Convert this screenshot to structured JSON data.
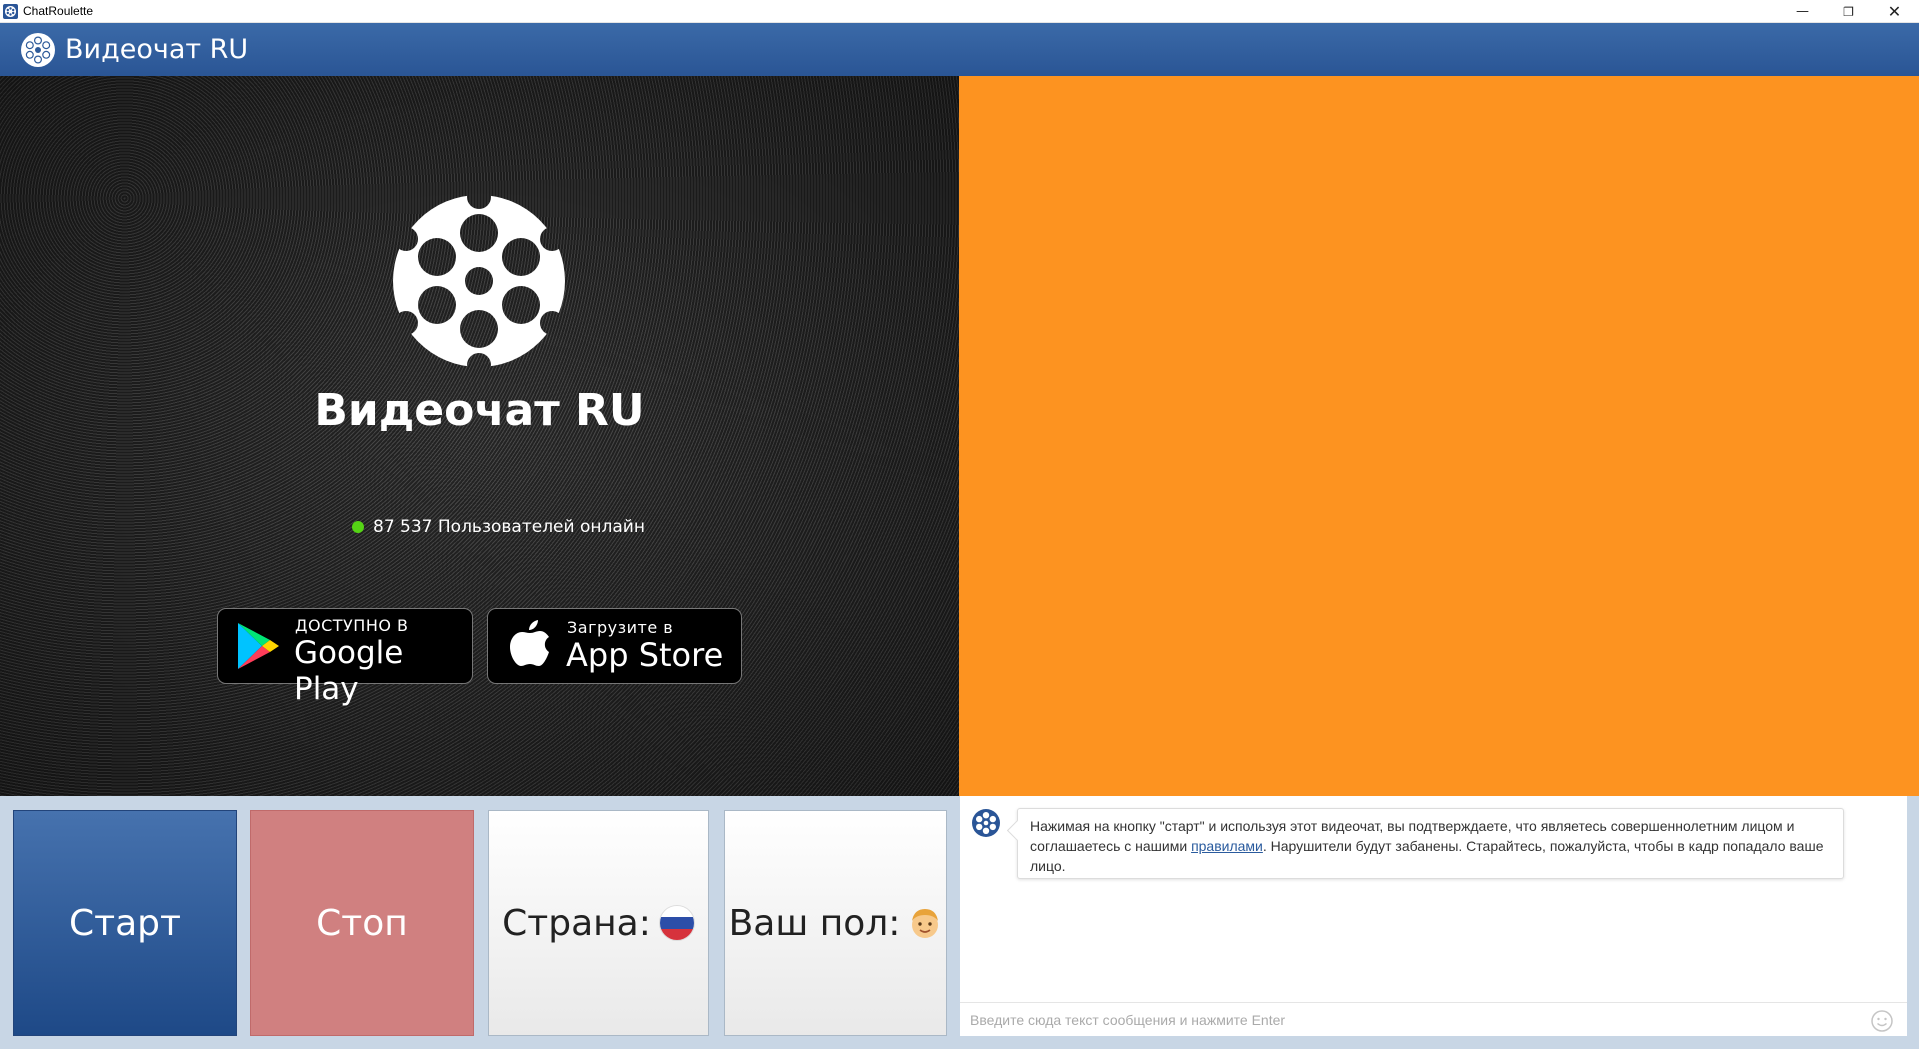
{
  "window": {
    "title": "ChatRoulette",
    "min_glyph": "—",
    "max_glyph": "❐",
    "close_glyph": "✕"
  },
  "header": {
    "brand": "Видеочат RU",
    "icon": "revolver-cylinder-icon"
  },
  "video_left": {
    "title": "Видеочат RU",
    "online_text": "87 537 Пользователей онлайн",
    "online_color": "#55d415",
    "google_play": {
      "small": "ДОСТУПНО В",
      "big": "Google Play"
    },
    "app_store": {
      "small": "Загрузите в",
      "big": "App Store"
    },
    "volume_level": 1.0
  },
  "video_right": {
    "color": "#fd9320"
  },
  "controls": {
    "start_label": "Старт",
    "stop_label": "Стоп",
    "country_label": "Страна:",
    "gender_label": "Ваш пол:",
    "country_flag": "russia-flag-icon",
    "gender_icon": "male-face-icon"
  },
  "chat": {
    "message_before_link": "Нажимая на кнопку \"старт\" и используя этот видеочат, вы подтверждаете, что являетесь совершеннолетним лицом и соглашаетесь с нашими ",
    "message_link": "правилами",
    "message_after_link": ". Нарушители будут забанены. Старайтесь, пожалуйста, чтобы в кадр попадало ваше лицо.",
    "input_placeholder": "Введите сюда текст сообщения и нажмите Enter"
  },
  "colors": {
    "header": "#2a5595",
    "start": "#2a5597",
    "stop": "#d08080"
  }
}
